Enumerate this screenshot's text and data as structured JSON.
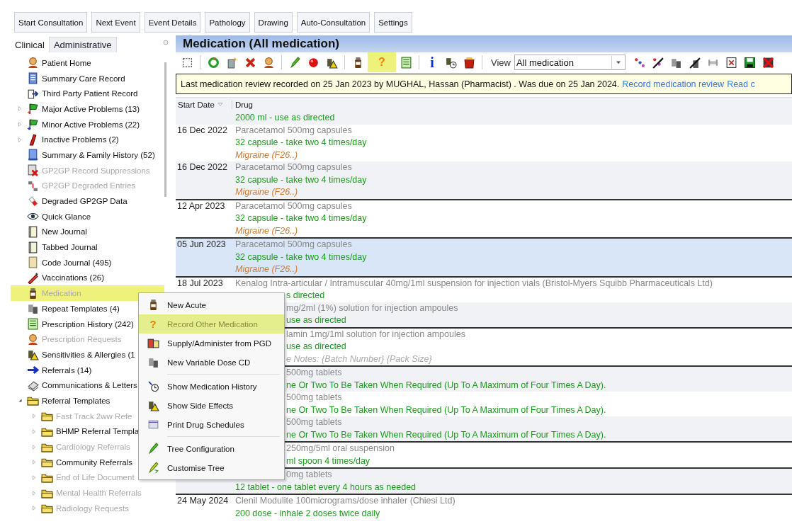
{
  "top_buttons": [
    "Start Consultation",
    "Next Event",
    "Event Details",
    "Pathology",
    "Drawing",
    "Auto-Consultation",
    "Settings"
  ],
  "sidebar": {
    "tabs": [
      {
        "label": "Clinical",
        "selected": true
      },
      {
        "label": "Administrative",
        "selected": false
      }
    ],
    "items": [
      {
        "label": "Patient Home",
        "disabled": false
      },
      {
        "label": "Summary Care Record",
        "disabled": false
      },
      {
        "label": "Third Party Patient Record",
        "disabled": false
      },
      {
        "label": "Major Active Problems (13)",
        "disabled": false,
        "expanded": false
      },
      {
        "label": "Minor Active Problems (22)",
        "disabled": false,
        "expanded": false
      },
      {
        "label": "Inactive Problems (2)",
        "disabled": false,
        "expanded": false
      },
      {
        "label": "Summary & Family History (52)",
        "disabled": false
      },
      {
        "label": "GP2GP Record Suppressions",
        "disabled": true
      },
      {
        "label": "GP2GP Degraded Entries",
        "disabled": true
      },
      {
        "label": "Degraded GP2GP Data",
        "disabled": false
      },
      {
        "label": "Quick Glance",
        "disabled": false
      },
      {
        "label": "New Journal",
        "disabled": false
      },
      {
        "label": "Tabbed Journal",
        "disabled": false
      },
      {
        "label": "Code Journal (495)",
        "disabled": false
      },
      {
        "label": "Vaccinations (26)",
        "disabled": false
      },
      {
        "label": "Medication",
        "disabled": true,
        "highlighted": true
      },
      {
        "label": "Repeat Templates (4)",
        "disabled": false
      },
      {
        "label": "Prescription History (242)",
        "disabled": false
      },
      {
        "label": "Prescription Requests",
        "disabled": true
      },
      {
        "label": "Sensitivities & Allergies (1",
        "disabled": false
      },
      {
        "label": "Referrals (14)",
        "disabled": false
      },
      {
        "label": "Communications & Letters",
        "disabled": false
      },
      {
        "label": "Referral Templates",
        "disabled": false,
        "expanded": true,
        "children": [
          {
            "label": "Fast Track 2ww Refe",
            "disabled": true,
            "expanded": false
          },
          {
            "label": "BHMP Referral Templa",
            "disabled": false,
            "expanded": false
          },
          {
            "label": "Cardiology Referrals",
            "disabled": true,
            "expanded": false
          },
          {
            "label": "Community Referrals",
            "disabled": false,
            "expanded": false
          },
          {
            "label": "End of Life Document",
            "disabled": true,
            "expanded": false
          },
          {
            "label": "Mental Health Referrals",
            "disabled": true,
            "expanded": false
          },
          {
            "label": "Radiology Requests",
            "disabled": true,
            "expanded": false
          }
        ]
      }
    ]
  },
  "panel": {
    "title": "Medication (All medication)",
    "toolbar": {
      "glyphs": [
        {
          "text": "?",
          "highlighted": true
        },
        {
          "text": "i",
          "highlighted": false
        }
      ],
      "view_label": "View",
      "view_value": "All medication"
    },
    "banner": {
      "text": "Last medication review recorded on 25 Jan 2023 by MUGHAL, Hassan (Pharmacist) . Was due on 25 Jan 2024.",
      "links": [
        "Record medication review",
        "Read c"
      ]
    },
    "columns": [
      "Start Date",
      "Drug"
    ],
    "rows": [
      {
        "selected": false,
        "separator": false,
        "lines": [
          {
            "kind": "dosage",
            "text": "2000 ml - use as directed"
          }
        ]
      },
      {
        "date": "16 Dec 2022",
        "selected": false,
        "separator": false,
        "lines": [
          {
            "kind": "drug",
            "text": "Paracetamol 500mg capsules"
          },
          {
            "kind": "dosage",
            "text": "32 capsule - take two 4 times/day"
          },
          {
            "kind": "indication",
            "text": "Migraine (F26..)"
          }
        ]
      },
      {
        "date": "16 Dec 2022",
        "selected": false,
        "separator": false,
        "lines": [
          {
            "kind": "drug",
            "text": "Paracetamol 500mg capsules"
          },
          {
            "kind": "dosage",
            "text": "32 capsule - take two 4 times/day"
          },
          {
            "kind": "indication",
            "text": "Migraine (F26..)"
          }
        ]
      },
      {
        "date": "12 Apr 2023",
        "selected": false,
        "separator": true,
        "lines": [
          {
            "kind": "drug",
            "text": "Paracetamol 500mg capsules"
          },
          {
            "kind": "dosage",
            "text": "32 capsule - take two 4 times/day"
          },
          {
            "kind": "indication",
            "text": "Migraine (F26..)"
          }
        ]
      },
      {
        "date": "05 Jun 2023",
        "selected": true,
        "separator": true,
        "lines": [
          {
            "kind": "drug",
            "text": "Paracetamol 500mg capsules"
          },
          {
            "kind": "dosage",
            "text": "32 capsule - take two 4 times/day"
          },
          {
            "kind": "indication",
            "text": "Migraine (F26..)"
          }
        ]
      },
      {
        "date": "18 Jul 2023",
        "selected": false,
        "separator": true,
        "lines": [
          {
            "kind": "drug",
            "text": "Kenalog Intra-articular / Intramuscular 40mg/1ml suspension for injection vials (Bristol-Myers Squibb Pharmaceuticals Ltd)"
          },
          {
            "kind": "dosage",
            "text": "s directed",
            "cut": true
          }
        ]
      },
      {
        "selected": false,
        "separator": false,
        "lines": [
          {
            "kind": "drug",
            "text": "mg/2ml (1%) solution for injection ampoules",
            "cut": true
          },
          {
            "kind": "dosage",
            "text": "use as directed",
            "cut": true
          }
        ]
      },
      {
        "selected": false,
        "separator": true,
        "lines": [
          {
            "kind": "drug",
            "text": "lamin 1mg/1ml solution for injection ampoules",
            "cut": true
          },
          {
            "kind": "dosage",
            "text": "use as directed",
            "cut": true
          },
          {
            "kind": "note",
            "text": "e Notes: {Batch Number} {Pack Size}",
            "cut": true
          }
        ]
      },
      {
        "selected": false,
        "separator": true,
        "lines": [
          {
            "kind": "drug",
            "text": "500mg tablets",
            "cut": true
          },
          {
            "kind": "dosage",
            "text": "ne Or Two To Be Taken When Required (Up To A Maximum of Four Times A Day).",
            "cut": true
          }
        ]
      },
      {
        "selected": false,
        "separator": false,
        "lines": [
          {
            "kind": "drug",
            "text": "500mg tablets",
            "cut": true
          },
          {
            "kind": "dosage",
            "text": "ne Or Two To Be Taken When Required (Up To A Maximum of Four Times A Day).",
            "cut": true
          }
        ]
      },
      {
        "selected": false,
        "separator": false,
        "lines": [
          {
            "kind": "drug",
            "text": "500mg tablets",
            "cut": true
          },
          {
            "kind": "dosage",
            "text": "ne Or Two To Be Taken When Required (Up To A Maximum of Four Times A Day).",
            "cut": true
          }
        ]
      },
      {
        "selected": false,
        "separator": true,
        "lines": [
          {
            "kind": "drug",
            "text": "250mg/5ml oral suspension",
            "cut": true
          },
          {
            "kind": "dosage",
            "text": "ml spoon 4 times/day",
            "cut": true
          }
        ]
      },
      {
        "selected": false,
        "separator": true,
        "lines": [
          {
            "kind": "drug",
            "text": "0mg tablets",
            "cut": true
          },
          {
            "kind": "dosage",
            "text": "12 tablet - one tablet every 4 hours as needed"
          }
        ]
      },
      {
        "date": "24 May 2024",
        "selected": false,
        "separator": true,
        "lines": [
          {
            "kind": "drug",
            "text": "Clenil Modulite 100micrograms/dose inhaler (Chiesi Ltd)"
          },
          {
            "kind": "dosage",
            "text": "200 dose - inhale 2 doses twice daily"
          }
        ]
      }
    ]
  },
  "context_menu": [
    {
      "label": "New Acute",
      "separator_before": false,
      "highlighted": false
    },
    {
      "label": "Record Other Medication",
      "glyph": "?",
      "separator_before": false,
      "highlighted": true
    },
    {
      "label": "Supply/Administer from PGD",
      "separator_before": false,
      "highlighted": false
    },
    {
      "label": "New Variable Dose CD",
      "separator_before": false,
      "highlighted": false
    },
    {
      "label": "Show Medication History",
      "separator_before": true,
      "highlighted": false
    },
    {
      "label": "Show Side Effects",
      "separator_before": false,
      "highlighted": false
    },
    {
      "label": "Print Drug Schedules",
      "separator_before": false,
      "highlighted": false
    },
    {
      "label": "Tree Configuration",
      "separator_before": true,
      "highlighted": false
    },
    {
      "label": "Customise Tree",
      "separator_before": false,
      "highlighted": false
    }
  ]
}
